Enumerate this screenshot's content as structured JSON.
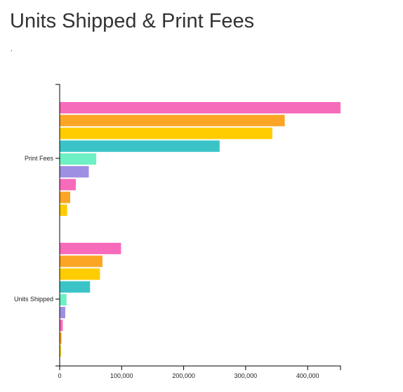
{
  "page": {
    "title": "Units Shipped & Print Fees",
    "subtitle": ","
  },
  "chart_data": {
    "type": "bar",
    "orientation": "horizontal",
    "categories": [
      "Print Fees",
      "Units Shipped"
    ],
    "series": [
      {
        "color": "#f76bbb",
        "values": [
          453000,
          99000
        ]
      },
      {
        "color": "#fca524",
        "values": [
          363000,
          69000
        ]
      },
      {
        "color": "#ffcc00",
        "values": [
          343000,
          65000
        ]
      },
      {
        "color": "#3bc4c8",
        "values": [
          258000,
          49000
        ]
      },
      {
        "color": "#6df0c3",
        "values": [
          59000,
          11000
        ]
      },
      {
        "color": "#9f8fe3",
        "values": [
          47000,
          9000
        ]
      },
      {
        "color": "#f76bbb",
        "values": [
          26000,
          5000
        ]
      },
      {
        "color": "#fca524",
        "values": [
          17000,
          3000
        ]
      },
      {
        "color": "#ffcc00",
        "values": [
          12000,
          2000
        ]
      }
    ],
    "xlim": [
      0,
      453000
    ],
    "xticks": [
      0,
      100000,
      200000,
      300000,
      400000
    ],
    "xtick_labels": [
      "0",
      "100,000",
      "200,000",
      "300,000",
      "400,000"
    ],
    "grid": false,
    "legend": "none"
  }
}
